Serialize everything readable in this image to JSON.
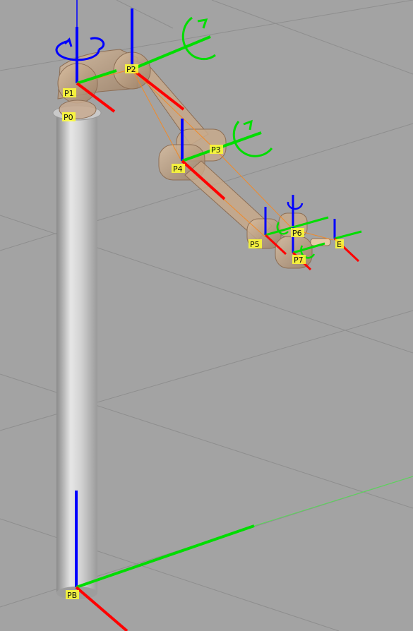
{
  "viewport": {
    "background": "#a3a3a3",
    "grid_color": "#8f8f8f"
  },
  "colors": {
    "x_axis": "#ff0000",
    "y_axis": "#00dd00",
    "z_axis": "#0000ff",
    "label_bg": "#ffff33",
    "link_color": "#c8a080",
    "column_color": "#c9c9c9"
  },
  "frames": {
    "pb": "PB",
    "p0": "P0",
    "p1": "P1",
    "p2": "P2",
    "p3": "P3",
    "p4": "P4",
    "p5": "P5",
    "p6": "P6",
    "p7": "P7",
    "e": "E"
  },
  "icons": [
    "rotate-z-icon",
    "rotate-y-icon"
  ]
}
